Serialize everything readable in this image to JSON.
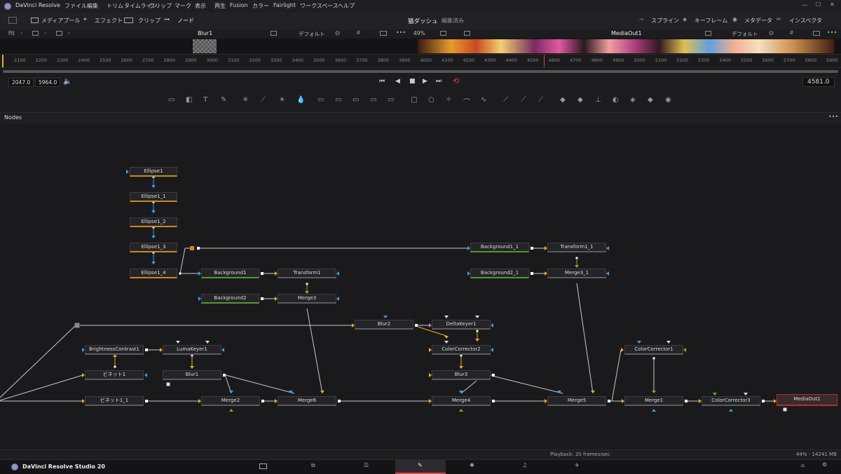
{
  "app": {
    "name": "DaVinci Resolve"
  },
  "menu": [
    "ファイル",
    "編集",
    "トリム",
    "タイムライン",
    "クリップ",
    "マーク",
    "表示",
    "再生",
    "Fusion",
    "カラー",
    "Fairlight",
    "ワークスペース",
    "ヘルプ"
  ],
  "toolbar": {
    "media_pool": "メディアプール",
    "effects": "エフェクト",
    "clips": "クリップ",
    "nodes": "ノード",
    "project": "猫ダッシュ",
    "status": "編集済み",
    "spline": "スプライン",
    "keyframes": "キーフレーム",
    "metadata": "メタデータ",
    "inspector": "インスペクタ"
  },
  "viewer_left": {
    "fit": "Fit",
    "title": "Blur1",
    "preset": "デフォルト"
  },
  "viewer_right": {
    "zoom": "49%",
    "title": "MediaOut1",
    "preset": "デフォルト"
  },
  "ruler_ticks": [
    "2100",
    "2200",
    "2300",
    "2400",
    "2500",
    "2600",
    "2700",
    "2800",
    "2900",
    "3000",
    "3100",
    "3200",
    "3300",
    "3400",
    "3500",
    "3600",
    "3700",
    "3800",
    "3900",
    "4000",
    "4100",
    "4200",
    "4300",
    "4400",
    "4500",
    "4600",
    "4700",
    "4800",
    "4900",
    "5000",
    "5100",
    "5200",
    "5300",
    "5400",
    "5500",
    "5600",
    "5700",
    "5800",
    "5900"
  ],
  "transport": {
    "start": "2047.0",
    "end": "5964.0",
    "current": "4581.0"
  },
  "panel": {
    "title": "Nodes",
    "more": "•••"
  },
  "nodes": [
    {
      "id": "Ellipse1",
      "label": "Ellipse1"
    },
    {
      "id": "Ellipse1_1",
      "label": "Ellipse1_1"
    },
    {
      "id": "Ellipse1_2",
      "label": "Ellipse1_2"
    },
    {
      "id": "Ellipse1_3",
      "label": "Ellipse1_3"
    },
    {
      "id": "Ellipse1_4",
      "label": "Ellipse1_4"
    },
    {
      "id": "Background1",
      "label": "Background1"
    },
    {
      "id": "Transform1",
      "label": "Transform1"
    },
    {
      "id": "Background2",
      "label": "Background2"
    },
    {
      "id": "Merge3",
      "label": "Merge3"
    },
    {
      "id": "Background1_1",
      "label": "Background1_1"
    },
    {
      "id": "Transform1_1",
      "label": "Transform1_1"
    },
    {
      "id": "Background2_1",
      "label": "Background2_1"
    },
    {
      "id": "Merge3_1",
      "label": "Merge3_1"
    },
    {
      "id": "Blur2",
      "label": "Blur2"
    },
    {
      "id": "DeltaKeyer1",
      "label": "DeltaKeyer1"
    },
    {
      "id": "BrightnessContrast1",
      "label": "BrightnessContrast1"
    },
    {
      "id": "LumaKeyer1",
      "label": "LumaKeyer1"
    },
    {
      "id": "ColorCorrector2",
      "label": "ColorCorrector2"
    },
    {
      "id": "ColorCorrector1",
      "label": "ColorCorrector1"
    },
    {
      "id": "Vignette1",
      "label": "ビネット1"
    },
    {
      "id": "Blur1",
      "label": "Blur1"
    },
    {
      "id": "Blur3",
      "label": "Blur3"
    },
    {
      "id": "Vignette1_1",
      "label": "ビネット1_1"
    },
    {
      "id": "Merge2",
      "label": "Merge2"
    },
    {
      "id": "Merge6",
      "label": "Merge6"
    },
    {
      "id": "Merge4",
      "label": "Merge4"
    },
    {
      "id": "Merge5",
      "label": "Merge5"
    },
    {
      "id": "Merge1",
      "label": "Merge1"
    },
    {
      "id": "ColorCorrector3",
      "label": "ColorCorrector3"
    },
    {
      "id": "MediaOut1",
      "label": "MediaOut1"
    }
  ],
  "status": {
    "playback": "Playback: 20 frames/sec",
    "memory": "44% - 14241 MB"
  },
  "bottom": {
    "product": "DaVinci Resolve Studio 20"
  },
  "colors": {
    "accent_orange": "#c98a1b",
    "accent_green": "#4f9a2f",
    "selected_red": "#b03030",
    "link_yellow": "#e0b020",
    "link_blue": "#3aa0e0"
  }
}
